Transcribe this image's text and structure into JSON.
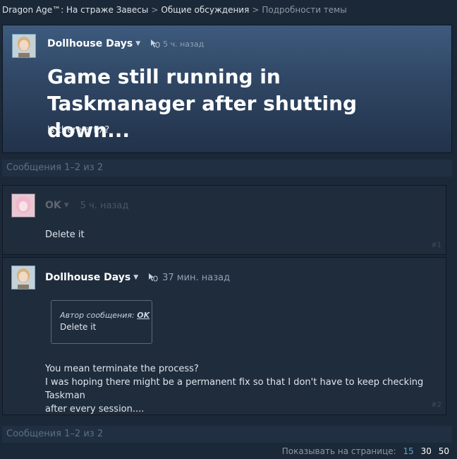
{
  "breadcrumb": {
    "game": "Dragon Age™: На страже Завесы",
    "forum": "Общие обсуждения",
    "current": "Подробности темы"
  },
  "topic": {
    "author": "Dollhouse Days",
    "time": "5 ч. назад",
    "title": "Game still running in Taskmanager after shutting down...",
    "body": "Is there a fix?"
  },
  "counter": {
    "top": "Сообщения 1–2 из 2",
    "bottom": "Сообщения 1–2 из 2"
  },
  "posts": [
    {
      "author": "OK",
      "time": "5 ч. назад",
      "body": "Delete it",
      "number": "#1"
    },
    {
      "author": "Dollhouse Days",
      "time": "37 мин. назад",
      "quote_label": "Автор сообщения:",
      "quote_author": "OK",
      "quote_text": "Delete it",
      "body_line1": "You mean terminate the process?",
      "body_line2": "I was hoping there might be a permanent fix so that I don't have to keep checking Taskman",
      "body_line3": "after every session....",
      "number": "#2"
    }
  ],
  "pagination": {
    "label": "Показывать на странице:",
    "options": [
      "15",
      "30",
      "50"
    ],
    "selected": "30"
  }
}
